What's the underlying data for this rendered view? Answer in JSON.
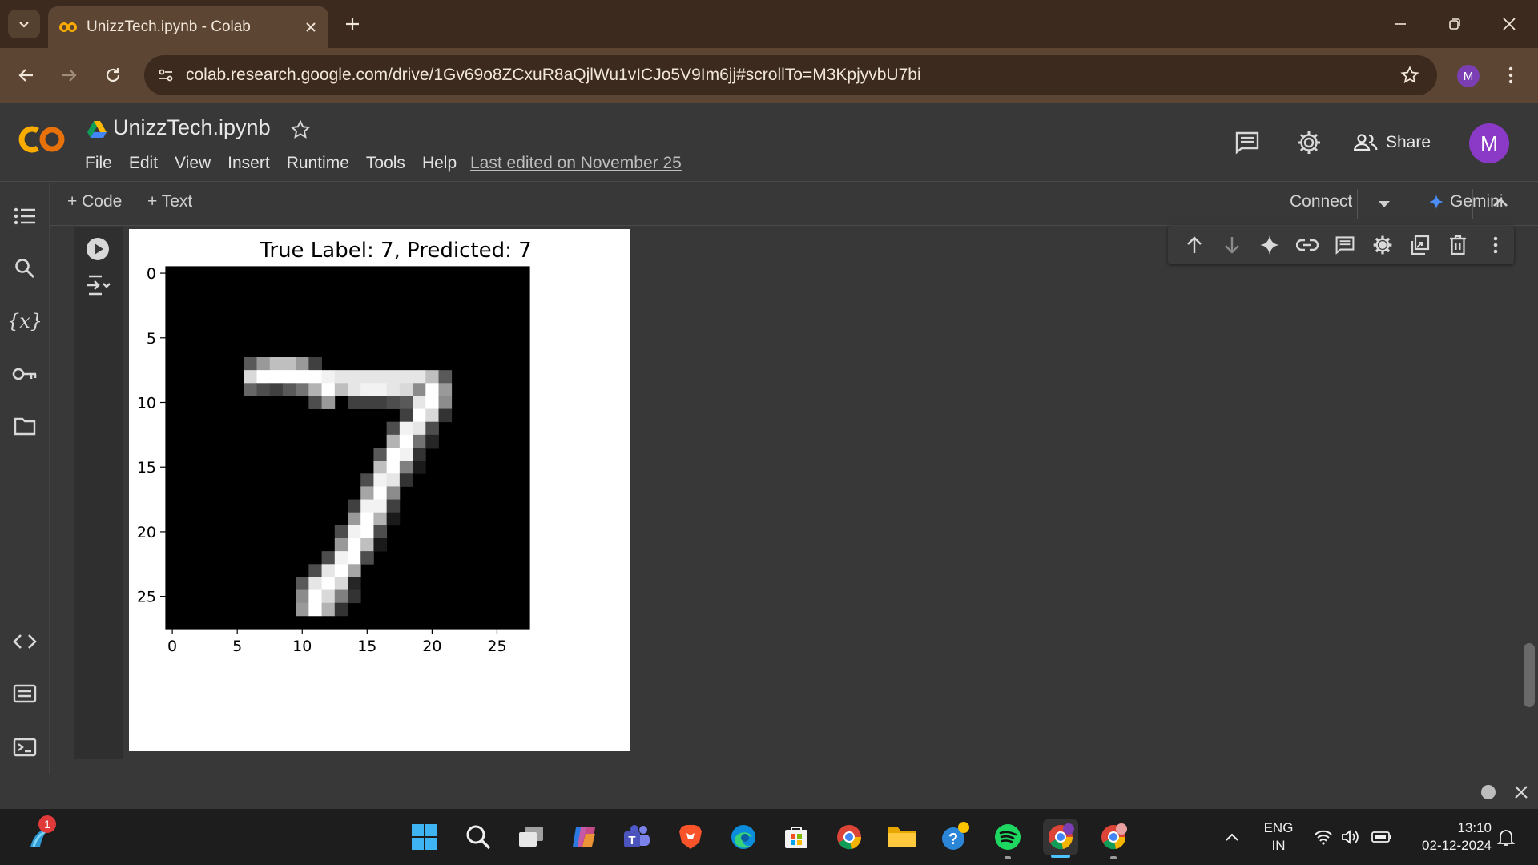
{
  "browser": {
    "tab_title": "UnizzTech.ipynb - Colab",
    "url": "colab.research.google.com/drive/1Gv69o8ZCxuR8aQjlWu1vICJo5V9Im6jj#scrollTo=M3KpjyvbU7bi",
    "profile_initial": "M"
  },
  "colab": {
    "logo_text": "CO",
    "notebook_name": "UnizzTech.ipynb",
    "menu": [
      "File",
      "Edit",
      "View",
      "Insert",
      "Runtime",
      "Tools",
      "Help"
    ],
    "last_edited": "Last edited on November 25",
    "share_label": "Share",
    "avatar_initial": "M",
    "add_code_label": "+ Code",
    "add_text_label": "+ Text",
    "connect_label": "Connect",
    "gemini_label": "Gemini"
  },
  "chart_data": {
    "type": "heatmap",
    "title": "True Label: 7, Predicted: 7",
    "colormap": "gray",
    "xlim": [
      -0.5,
      27.5
    ],
    "ylim": [
      27.5,
      -0.5
    ],
    "xticks": [
      0,
      5,
      10,
      15,
      20,
      25
    ],
    "yticks": [
      0,
      5,
      10,
      15,
      20,
      25
    ],
    "grid": false,
    "pixels": [
      {
        "x": 6,
        "y": 7,
        "v": 0.35
      },
      {
        "x": 7,
        "y": 7,
        "v": 0.6
      },
      {
        "x": 8,
        "y": 7,
        "v": 0.75
      },
      {
        "x": 9,
        "y": 7,
        "v": 0.75
      },
      {
        "x": 10,
        "y": 7,
        "v": 0.6
      },
      {
        "x": 11,
        "y": 7,
        "v": 0.25
      },
      {
        "x": 6,
        "y": 8,
        "v": 0.85
      },
      {
        "x": 7,
        "y": 8,
        "v": 1
      },
      {
        "x": 8,
        "y": 8,
        "v": 1
      },
      {
        "x": 9,
        "y": 8,
        "v": 1
      },
      {
        "x": 10,
        "y": 8,
        "v": 1
      },
      {
        "x": 11,
        "y": 8,
        "v": 1
      },
      {
        "x": 12,
        "y": 8,
        "v": 0.95
      },
      {
        "x": 13,
        "y": 8,
        "v": 0.9
      },
      {
        "x": 14,
        "y": 8,
        "v": 0.9
      },
      {
        "x": 15,
        "y": 8,
        "v": 0.9
      },
      {
        "x": 16,
        "y": 8,
        "v": 0.9
      },
      {
        "x": 17,
        "y": 8,
        "v": 0.9
      },
      {
        "x": 18,
        "y": 8,
        "v": 0.9
      },
      {
        "x": 19,
        "y": 8,
        "v": 0.9
      },
      {
        "x": 20,
        "y": 8,
        "v": 0.75
      },
      {
        "x": 21,
        "y": 8,
        "v": 0.35
      },
      {
        "x": 6,
        "y": 9,
        "v": 0.4
      },
      {
        "x": 7,
        "y": 9,
        "v": 0.3
      },
      {
        "x": 8,
        "y": 9,
        "v": 0.25
      },
      {
        "x": 9,
        "y": 9,
        "v": 0.35
      },
      {
        "x": 10,
        "y": 9,
        "v": 0.45
      },
      {
        "x": 11,
        "y": 9,
        "v": 0.7
      },
      {
        "x": 12,
        "y": 9,
        "v": 1
      },
      {
        "x": 13,
        "y": 9,
        "v": 0.75
      },
      {
        "x": 14,
        "y": 9,
        "v": 0.9
      },
      {
        "x": 15,
        "y": 9,
        "v": 0.95
      },
      {
        "x": 16,
        "y": 9,
        "v": 0.95
      },
      {
        "x": 17,
        "y": 9,
        "v": 0.9
      },
      {
        "x": 18,
        "y": 9,
        "v": 0.85
      },
      {
        "x": 19,
        "y": 9,
        "v": 0.55
      },
      {
        "x": 20,
        "y": 9,
        "v": 1
      },
      {
        "x": 21,
        "y": 9,
        "v": 0.6
      },
      {
        "x": 11,
        "y": 10,
        "v": 0.3
      },
      {
        "x": 12,
        "y": 10,
        "v": 0.6
      },
      {
        "x": 14,
        "y": 10,
        "v": 0.25
      },
      {
        "x": 15,
        "y": 10,
        "v": 0.25
      },
      {
        "x": 16,
        "y": 10,
        "v": 0.25
      },
      {
        "x": 17,
        "y": 10,
        "v": 0.3
      },
      {
        "x": 18,
        "y": 10,
        "v": 0.35
      },
      {
        "x": 19,
        "y": 10,
        "v": 0.9
      },
      {
        "x": 20,
        "y": 10,
        "v": 1
      },
      {
        "x": 21,
        "y": 10,
        "v": 0.55
      },
      {
        "x": 18,
        "y": 11,
        "v": 0.25
      },
      {
        "x": 19,
        "y": 11,
        "v": 1
      },
      {
        "x": 20,
        "y": 11,
        "v": 0.85
      },
      {
        "x": 21,
        "y": 11,
        "v": 0.2
      },
      {
        "x": 17,
        "y": 12,
        "v": 0.3
      },
      {
        "x": 18,
        "y": 12,
        "v": 0.95
      },
      {
        "x": 19,
        "y": 12,
        "v": 0.9
      },
      {
        "x": 20,
        "y": 12,
        "v": 0.3
      },
      {
        "x": 17,
        "y": 13,
        "v": 0.7
      },
      {
        "x": 18,
        "y": 13,
        "v": 1
      },
      {
        "x": 19,
        "y": 13,
        "v": 0.45
      },
      {
        "x": 20,
        "y": 13,
        "v": 0.15
      },
      {
        "x": 16,
        "y": 14,
        "v": 0.35
      },
      {
        "x": 17,
        "y": 14,
        "v": 1
      },
      {
        "x": 18,
        "y": 14,
        "v": 0.95
      },
      {
        "x": 19,
        "y": 14,
        "v": 0.2
      },
      {
        "x": 16,
        "y": 15,
        "v": 0.75
      },
      {
        "x": 17,
        "y": 15,
        "v": 1
      },
      {
        "x": 18,
        "y": 15,
        "v": 0.5
      },
      {
        "x": 19,
        "y": 15,
        "v": 0.1
      },
      {
        "x": 15,
        "y": 16,
        "v": 0.3
      },
      {
        "x": 16,
        "y": 16,
        "v": 0.95
      },
      {
        "x": 17,
        "y": 16,
        "v": 0.9
      },
      {
        "x": 18,
        "y": 16,
        "v": 0.2
      },
      {
        "x": 15,
        "y": 17,
        "v": 0.65
      },
      {
        "x": 16,
        "y": 17,
        "v": 1
      },
      {
        "x": 17,
        "y": 17,
        "v": 0.55
      },
      {
        "x": 14,
        "y": 18,
        "v": 0.25
      },
      {
        "x": 15,
        "y": 18,
        "v": 0.95
      },
      {
        "x": 16,
        "y": 18,
        "v": 0.95
      },
      {
        "x": 17,
        "y": 18,
        "v": 0.25
      },
      {
        "x": 14,
        "y": 19,
        "v": 0.6
      },
      {
        "x": 15,
        "y": 19,
        "v": 1
      },
      {
        "x": 16,
        "y": 19,
        "v": 0.7
      },
      {
        "x": 17,
        "y": 19,
        "v": 0.1
      },
      {
        "x": 13,
        "y": 20,
        "v": 0.3
      },
      {
        "x": 14,
        "y": 20,
        "v": 0.95
      },
      {
        "x": 15,
        "y": 20,
        "v": 1
      },
      {
        "x": 16,
        "y": 20,
        "v": 0.3
      },
      {
        "x": 13,
        "y": 21,
        "v": 0.6
      },
      {
        "x": 14,
        "y": 21,
        "v": 1
      },
      {
        "x": 15,
        "y": 21,
        "v": 0.75
      },
      {
        "x": 16,
        "y": 21,
        "v": 0.1
      },
      {
        "x": 12,
        "y": 22,
        "v": 0.3
      },
      {
        "x": 13,
        "y": 22,
        "v": 0.95
      },
      {
        "x": 14,
        "y": 22,
        "v": 1
      },
      {
        "x": 15,
        "y": 22,
        "v": 0.3
      },
      {
        "x": 11,
        "y": 23,
        "v": 0.3
      },
      {
        "x": 12,
        "y": 23,
        "v": 0.9
      },
      {
        "x": 13,
        "y": 23,
        "v": 1
      },
      {
        "x": 14,
        "y": 23,
        "v": 0.65
      },
      {
        "x": 10,
        "y": 24,
        "v": 0.35
      },
      {
        "x": 11,
        "y": 24,
        "v": 0.9
      },
      {
        "x": 12,
        "y": 24,
        "v": 1
      },
      {
        "x": 13,
        "y": 24,
        "v": 0.85
      },
      {
        "x": 14,
        "y": 24,
        "v": 0.15
      },
      {
        "x": 10,
        "y": 25,
        "v": 0.55
      },
      {
        "x": 11,
        "y": 25,
        "v": 1
      },
      {
        "x": 12,
        "y": 25,
        "v": 0.85
      },
      {
        "x": 13,
        "y": 25,
        "v": 0.5
      },
      {
        "x": 14,
        "y": 25,
        "v": 0.2
      },
      {
        "x": 10,
        "y": 26,
        "v": 0.6
      },
      {
        "x": 11,
        "y": 26,
        "v": 1
      },
      {
        "x": 12,
        "y": 26,
        "v": 0.7
      },
      {
        "x": 13,
        "y": 26,
        "v": 0.2
      }
    ]
  },
  "taskbar": {
    "notification_badge": "1",
    "lang_line1": "ENG",
    "lang_line2": "IN",
    "time": "13:10",
    "date": "02-12-2024"
  },
  "icons": {
    "rail": [
      "toc-icon",
      "search-icon",
      "variables-icon",
      "key-icon",
      "folder-icon",
      "code-snippets-icon",
      "command-palette-icon",
      "terminal-icon"
    ],
    "cell_tools": [
      "arrow-up-icon",
      "arrow-down-icon",
      "sparkle-icon",
      "link-icon",
      "comment-icon",
      "gear-icon",
      "mirror-cell-icon",
      "delete-icon",
      "more-vert-icon"
    ]
  },
  "colors": {
    "chrome_tabbar": "#3b2a1d",
    "chrome_toolbar": "#5c4532",
    "colab_bg": "#383838",
    "avatar": "#8a3ac6",
    "logo_orange": "#f9ab00"
  }
}
